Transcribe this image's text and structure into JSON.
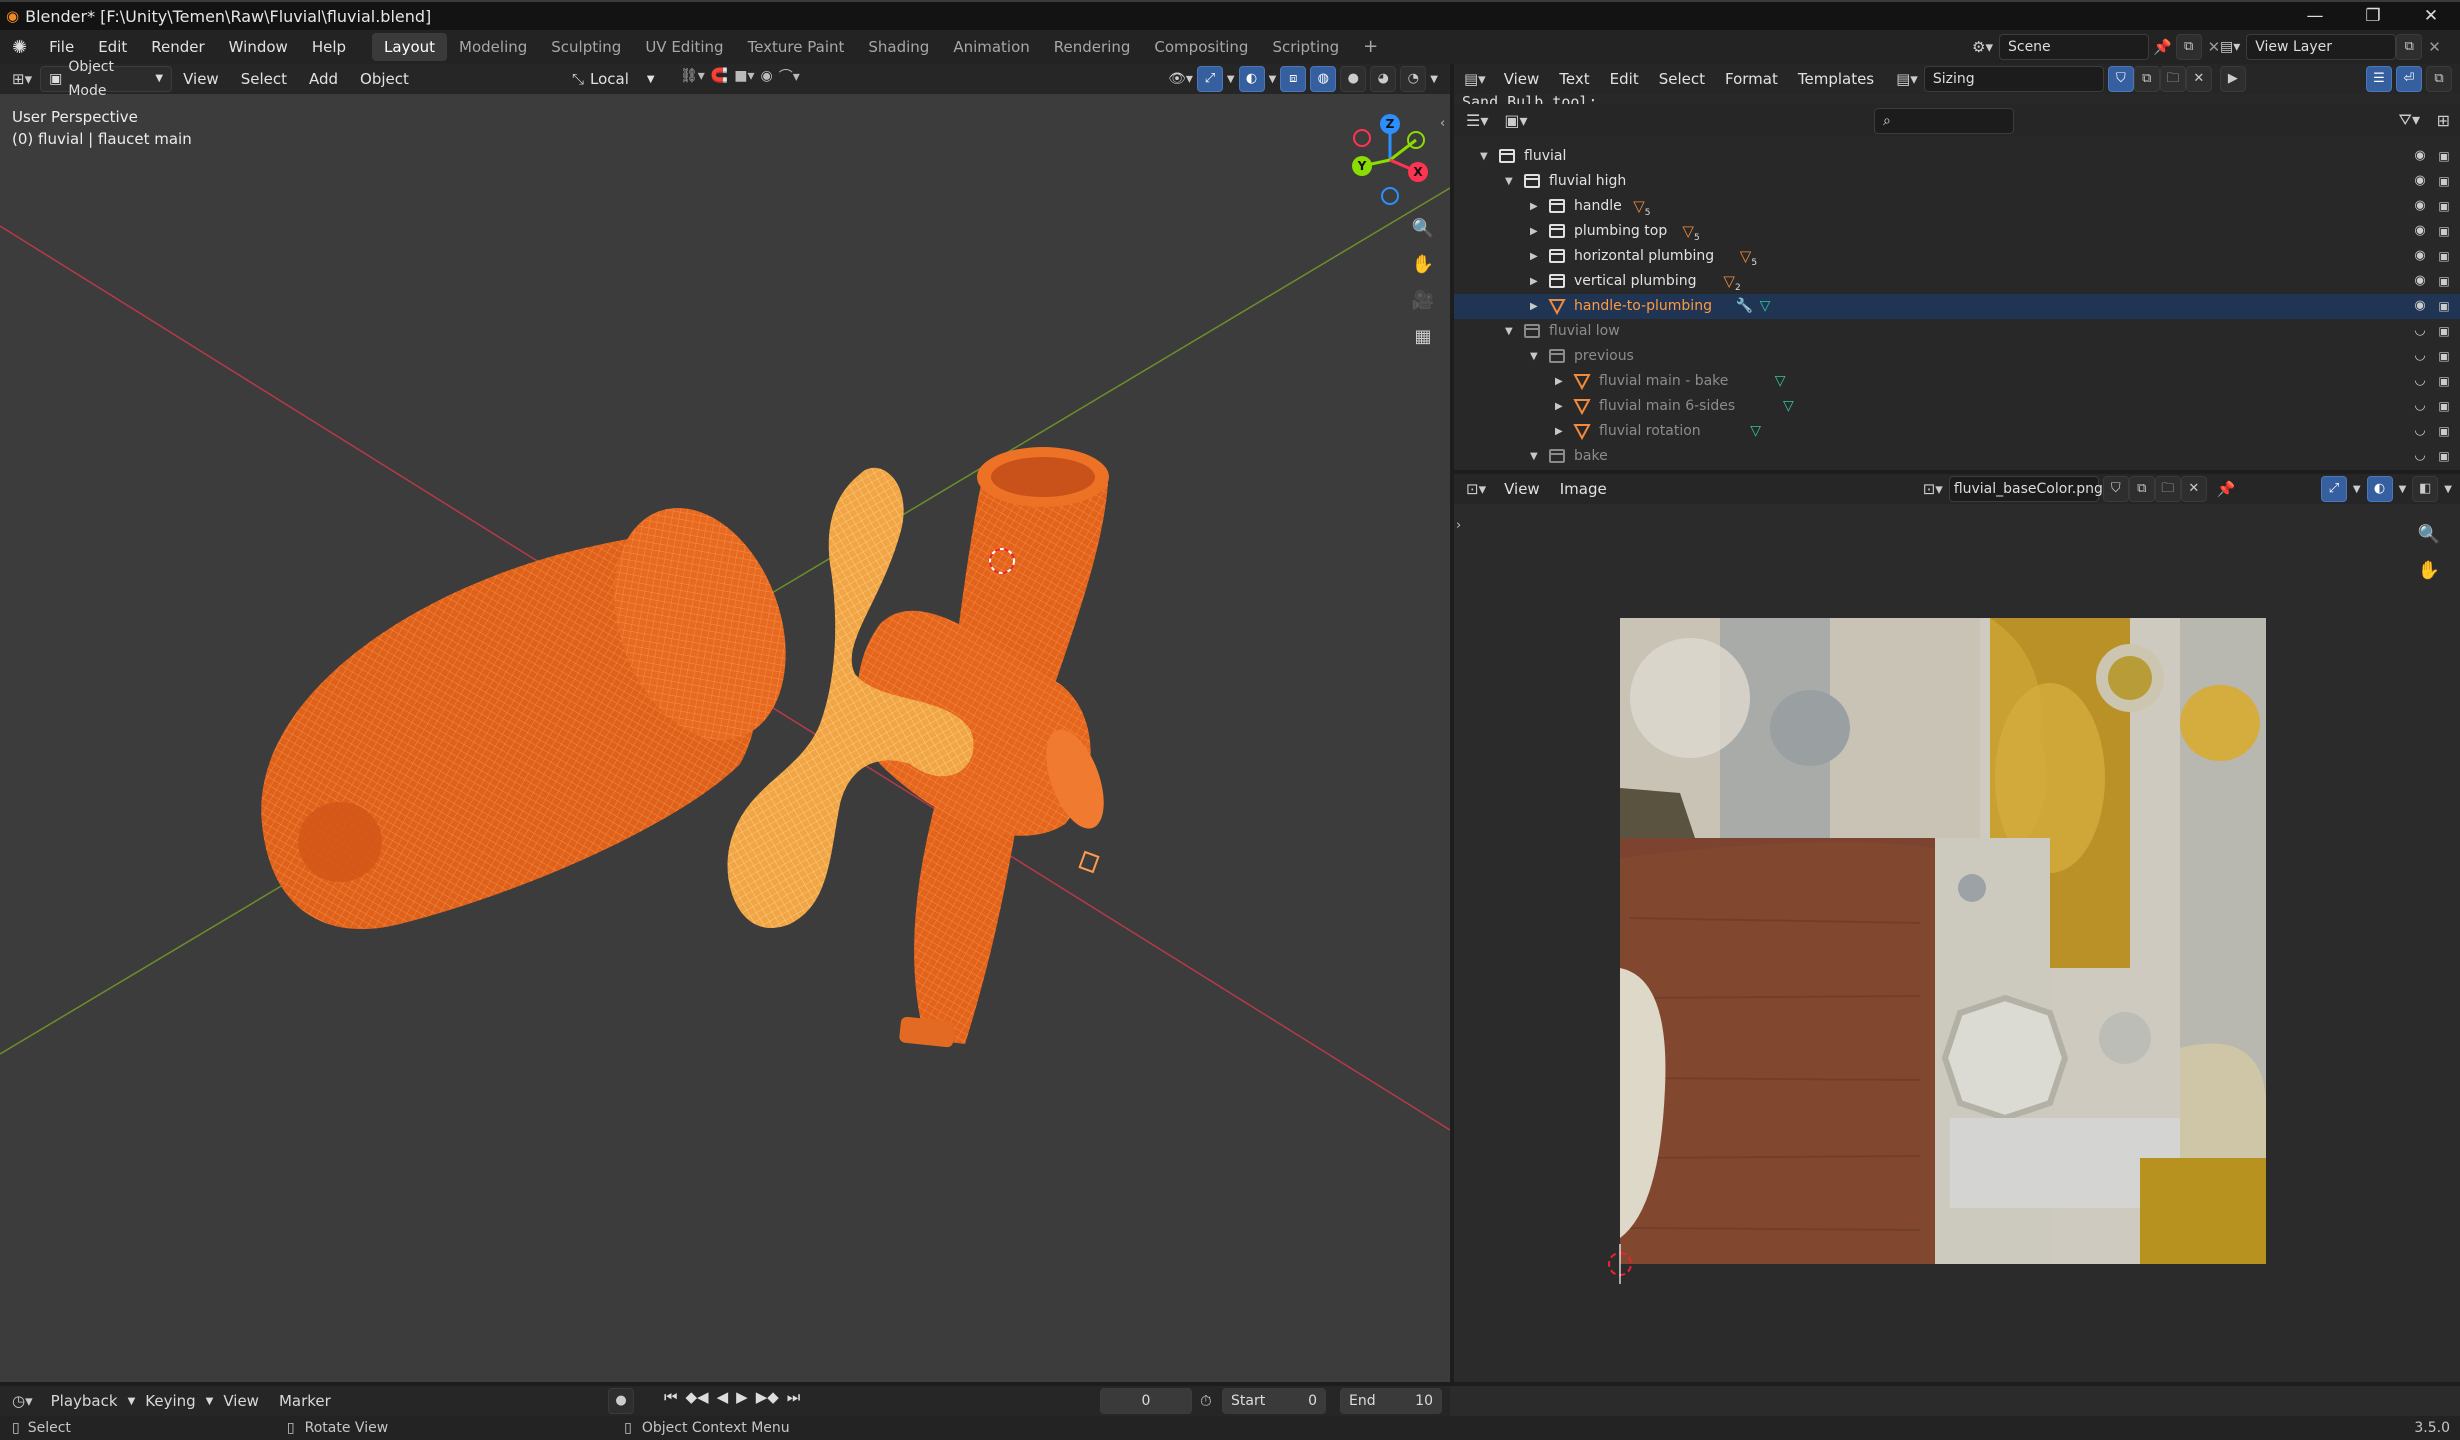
{
  "window": {
    "title": "Blender* [F:\\Unity\\Temen\\Raw\\Fluvial\\fluvial.blend]"
  },
  "menu": [
    "File",
    "Edit",
    "Render",
    "Window",
    "Help"
  ],
  "workspaces": [
    "Layout",
    "Modeling",
    "Sculpting",
    "UV Editing",
    "Texture Paint",
    "Shading",
    "Animation",
    "Rendering",
    "Compositing",
    "Scripting"
  ],
  "active_workspace": "Layout",
  "scene": {
    "name": "Scene",
    "view_layer": "View Layer"
  },
  "viewport": {
    "mode": "Object Mode",
    "menu": [
      "View",
      "Select",
      "Add",
      "Object"
    ],
    "orientation": "Local",
    "overlay_title": "User Perspective",
    "overlay_object": "(0) fluvial | flaucet main",
    "gizmo_axes": [
      "X",
      "Y",
      "Z"
    ]
  },
  "text_editor": {
    "menu": [
      "View",
      "Text",
      "Edit",
      "Select",
      "Format",
      "Templates"
    ],
    "text_name": "Sizing",
    "peek_line": "Sand Bulb tool:"
  },
  "outliner": {
    "items": [
      {
        "name": "fluvial",
        "depth": 0,
        "type": "collection",
        "expanded": true,
        "dim": false,
        "badge": ""
      },
      {
        "name": "fluvial high",
        "depth": 1,
        "type": "collection",
        "expanded": true,
        "dim": false,
        "badge": ""
      },
      {
        "name": "handle",
        "depth": 2,
        "type": "collection",
        "expanded": false,
        "dim": false,
        "badge": "5"
      },
      {
        "name": "plumbing top",
        "depth": 2,
        "type": "collection",
        "expanded": false,
        "dim": false,
        "badge": "5"
      },
      {
        "name": "horizontal plumbing",
        "depth": 2,
        "type": "collection",
        "expanded": false,
        "dim": false,
        "badge": "5"
      },
      {
        "name": "vertical plumbing",
        "depth": 2,
        "type": "collection",
        "expanded": false,
        "dim": false,
        "badge": "2"
      },
      {
        "name": "handle-to-plumbing",
        "depth": 2,
        "type": "mesh",
        "expanded": false,
        "dim": false,
        "badge": "",
        "selected": true
      },
      {
        "name": "fluvial low",
        "depth": 1,
        "type": "collection",
        "expanded": true,
        "dim": true,
        "badge": ""
      },
      {
        "name": "previous",
        "depth": 2,
        "type": "collection",
        "expanded": true,
        "dim": true,
        "badge": ""
      },
      {
        "name": "fluvial main - bake",
        "depth": 3,
        "type": "mesh",
        "expanded": false,
        "dim": true,
        "badge": ""
      },
      {
        "name": "fluvial main 6-sides",
        "depth": 3,
        "type": "mesh",
        "expanded": false,
        "dim": true,
        "badge": ""
      },
      {
        "name": "fluvial rotation",
        "depth": 3,
        "type": "mesh",
        "expanded": false,
        "dim": true,
        "badge": ""
      },
      {
        "name": "bake",
        "depth": 2,
        "type": "collection",
        "expanded": true,
        "dim": true,
        "badge": ""
      }
    ]
  },
  "image_editor": {
    "menu": [
      "View",
      "Image"
    ],
    "image_name": "fluvial_baseColor.png"
  },
  "timeline": {
    "menu": [
      "Playback",
      "Keying",
      "View",
      "Marker"
    ],
    "current_frame": "0",
    "start_label": "Start",
    "start": "0",
    "end_label": "End",
    "end": "10"
  },
  "status": {
    "hints": [
      "Select",
      "Rotate View",
      "Object Context Menu"
    ],
    "version": "3.5.0"
  },
  "colors": {
    "accent_blue": "#4b78b8",
    "selection_orange": "#ff6a00",
    "active_yellow": "#ffa94a",
    "x_axis": "#ff3352",
    "y_axis": "#8bdc00",
    "z_axis": "#2c8fff"
  }
}
